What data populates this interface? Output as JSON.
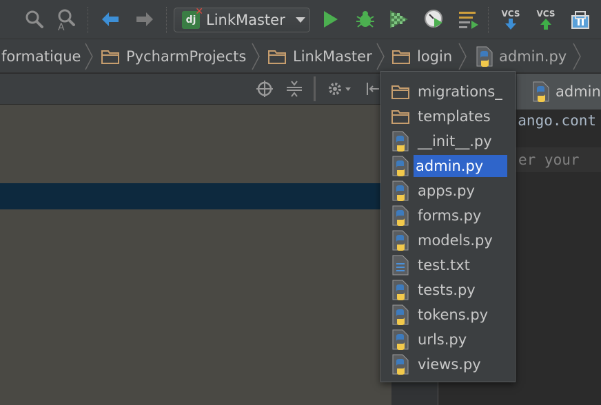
{
  "toolbar": {
    "run_config_label": "LinkMaster",
    "vcs_update_label": "VCS",
    "vcs_commit_label": "VCS"
  },
  "breadcrumb": [
    {
      "label": "formatique",
      "icon": "folder-icon"
    },
    {
      "label": "PycharmProjects",
      "icon": "folder-icon"
    },
    {
      "label": "LinkMaster",
      "icon": "folder-icon"
    },
    {
      "label": "login",
      "icon": "folder-icon"
    },
    {
      "label": "admin.py",
      "icon": "python-file-icon"
    }
  ],
  "editor": {
    "tab_label": "admin",
    "line1": "django.cont",
    "line2": "er your"
  },
  "popup": {
    "items": [
      {
        "label": "migrations_",
        "icon": "folder-icon"
      },
      {
        "label": "templates",
        "icon": "folder-icon"
      },
      {
        "label": "__init__.py",
        "icon": "python-file-icon"
      },
      {
        "label": "admin.py",
        "icon": "python-file-icon",
        "selected": true
      },
      {
        "label": "apps.py",
        "icon": "python-file-icon"
      },
      {
        "label": "forms.py",
        "icon": "python-file-icon"
      },
      {
        "label": "models.py",
        "icon": "python-file-icon"
      },
      {
        "label": "test.txt",
        "icon": "text-file-icon"
      },
      {
        "label": "tests.py",
        "icon": "python-file-icon"
      },
      {
        "label": "tokens.py",
        "icon": "python-file-icon"
      },
      {
        "label": "urls.py",
        "icon": "python-file-icon"
      },
      {
        "label": "views.py",
        "icon": "python-file-icon"
      }
    ]
  },
  "colors": {
    "selection": "#2f65ca",
    "panel_selection": "#0d293e",
    "run_green": "#4caf50",
    "vcs_blue": "#3d8fd6",
    "vcs_green": "#3fae48"
  }
}
